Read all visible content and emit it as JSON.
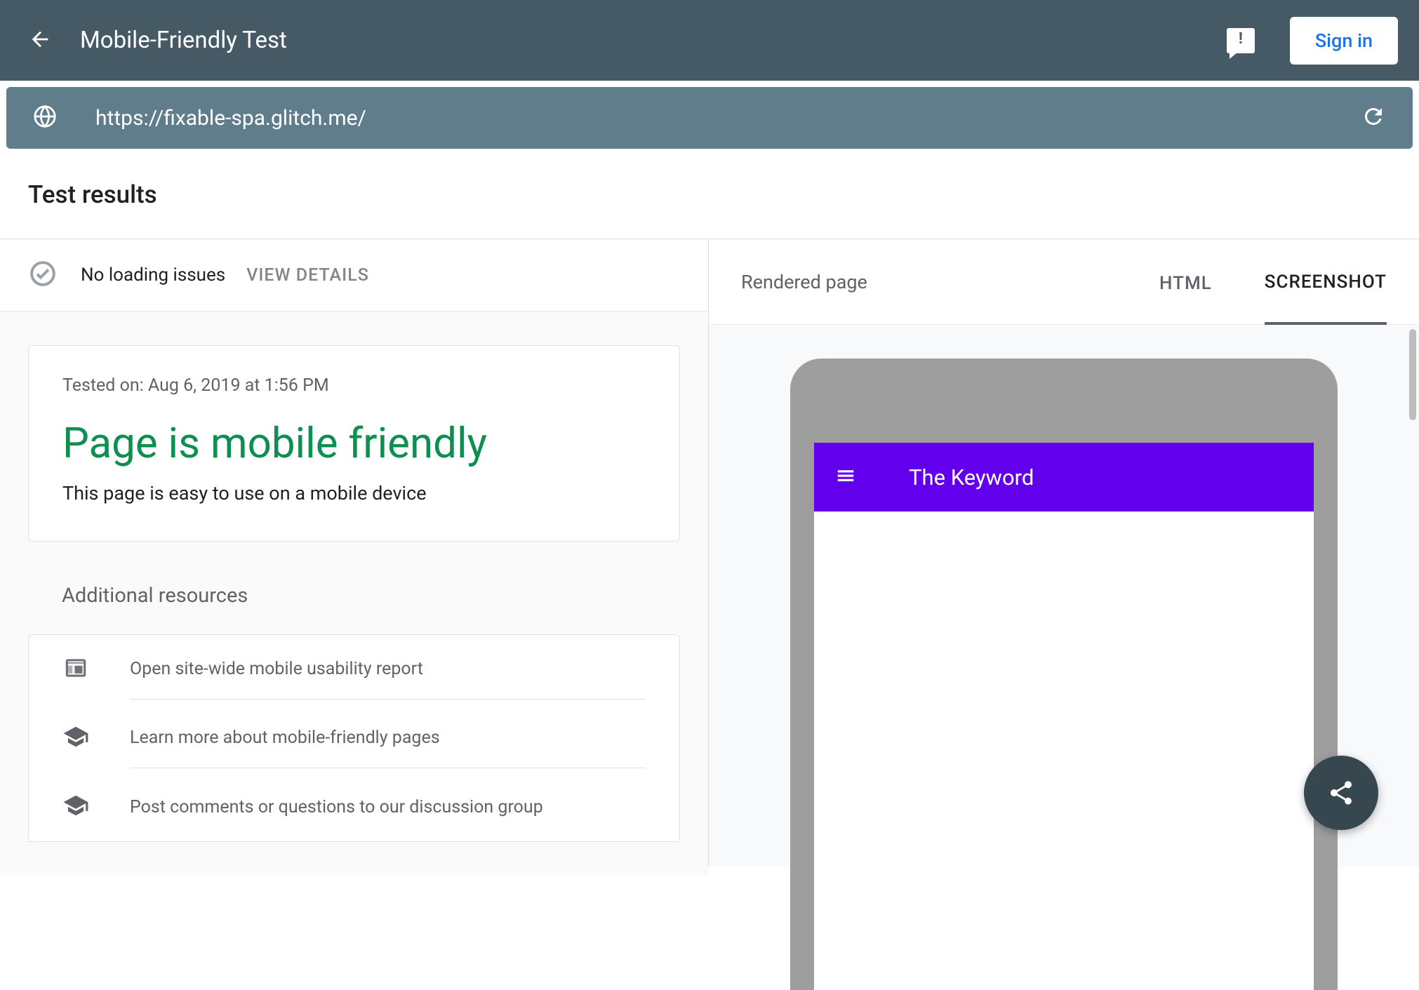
{
  "header": {
    "title": "Mobile-Friendly Test",
    "signin_label": "Sign in"
  },
  "url_bar": {
    "url": "https://fixable-spa.glitch.me/"
  },
  "results": {
    "section_title": "Test results",
    "loading_status": "No loading issues",
    "view_details": "VIEW DETAILS",
    "tested_on": "Tested on: Aug 6, 2019 at 1:56 PM",
    "headline": "Page is mobile friendly",
    "description": "This page is easy to use on a mobile device"
  },
  "additional": {
    "title": "Additional resources",
    "items": [
      {
        "label": "Open site-wide mobile usability report"
      },
      {
        "label": "Learn more about mobile-friendly pages"
      },
      {
        "label": "Post comments or questions to our discussion group"
      }
    ]
  },
  "right_panel": {
    "rendered_label": "Rendered page",
    "tabs": [
      {
        "label": "HTML",
        "active": false
      },
      {
        "label": "SCREENSHOT",
        "active": true
      }
    ]
  },
  "preview": {
    "app_title": "The Keyword"
  }
}
